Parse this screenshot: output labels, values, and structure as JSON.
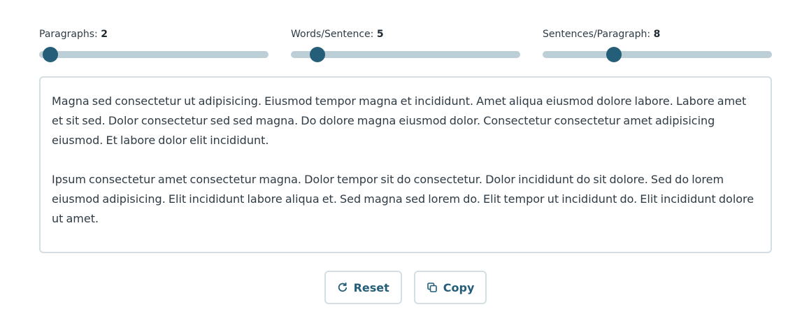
{
  "sliders": [
    {
      "label": "Paragraphs:",
      "value": "2",
      "fraction": 0.05
    },
    {
      "label": "Words/Sentence:",
      "value": "5",
      "fraction": 0.115
    },
    {
      "label": "Sentences/Paragraph:",
      "value": "8",
      "fraction": 0.31
    }
  ],
  "text": {
    "paragraphs": [
      "Magna sed consectetur ut adipisicing. Eiusmod tempor magna et incididunt. Amet aliqua eiusmod dolore labore. Labore amet et sit sed. Dolor consectetur sed sed magna. Do dolore magna eiusmod dolor. Consectetur consectetur amet adipisicing eiusmod. Et labore dolor elit incididunt.",
      "Ipsum consectetur amet consectetur magna. Dolor tempor sit do consectetur. Dolor incididunt do sit dolore. Sed do lorem eiusmod adipisicing. Elit incididunt labore aliqua et. Sed magna sed lorem do. Elit tempor ut incididunt do. Elit incididunt dolore ut amet."
    ]
  },
  "buttons": {
    "reset": {
      "label": "Reset",
      "icon": "refresh-icon"
    },
    "copy": {
      "label": "Copy",
      "icon": "copy-icon"
    }
  },
  "colors": {
    "accent": "#255e78",
    "track": "#bccfd6",
    "border": "#d5dee3",
    "text": "#2f3b44"
  }
}
